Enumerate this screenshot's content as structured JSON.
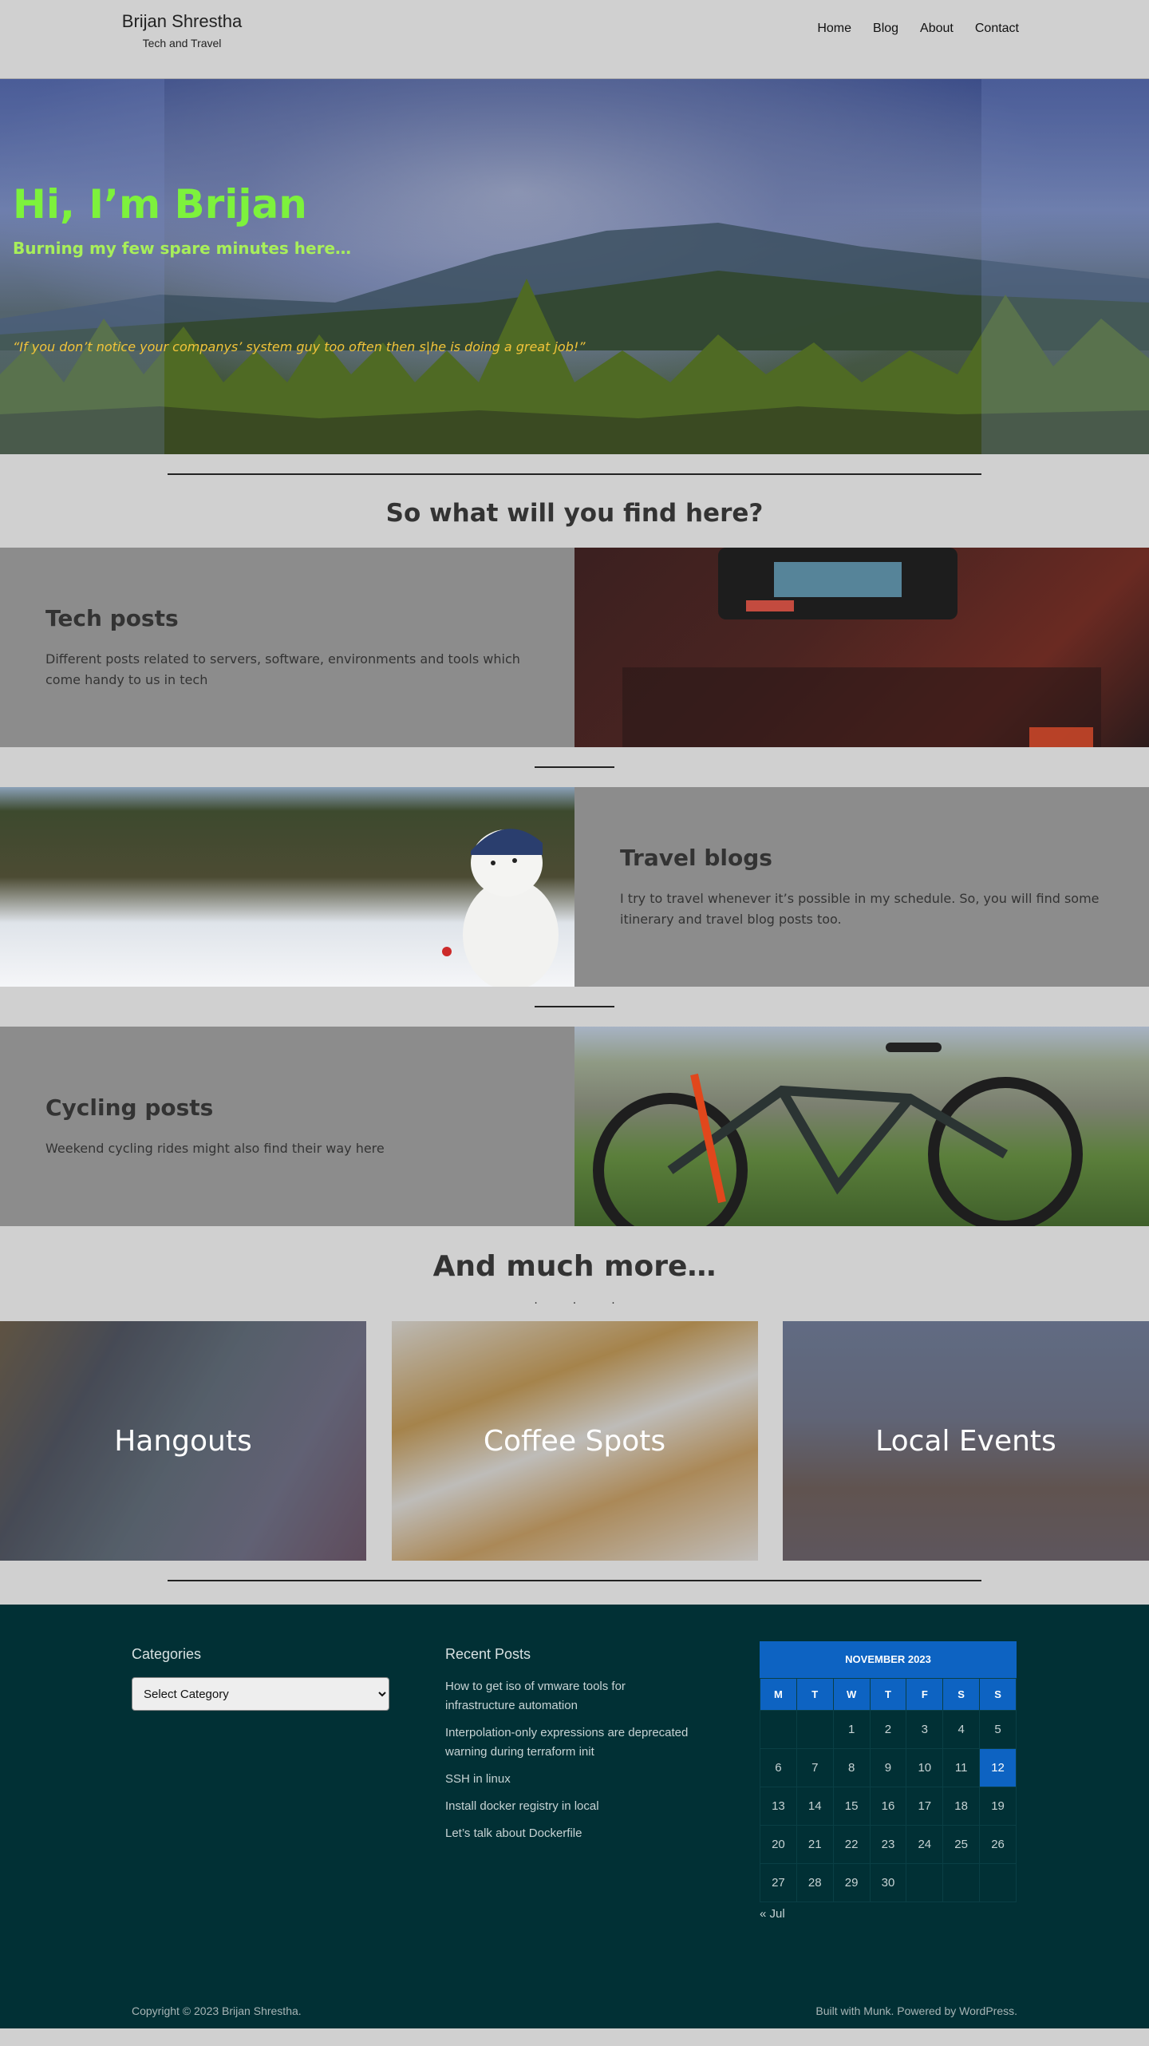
{
  "header": {
    "site_title": "Brijan Shrestha",
    "tagline": "Tech and Travel",
    "nav": [
      "Home",
      "Blog",
      "About",
      "Contact"
    ]
  },
  "hero": {
    "title": "Hi, I’m Brijan",
    "subtitle": "Burning my few spare minutes here…",
    "quote": "“If you don’t notice your companys’ system guy too often then s|he is doing a great job!”"
  },
  "intro_heading": "So what will you find here?",
  "features": [
    {
      "title": "Tech posts",
      "text": "Different posts related to servers, software, environments and tools which come handy to us in tech"
    },
    {
      "title": "Travel blogs",
      "text": "I try to travel whenever it’s possible in my schedule. So, you will find some itinerary and travel blog posts too."
    },
    {
      "title": "Cycling posts",
      "text": "Weekend cycling rides might also find their way here"
    }
  ],
  "more_heading": "And much more…",
  "dots": "...",
  "cards": [
    "Hangouts",
    "Coffee Spots",
    "Local Events"
  ],
  "footer": {
    "categories": {
      "heading": "Categories",
      "select_value": "Select Category"
    },
    "recent": {
      "heading": "Recent Posts",
      "posts": [
        "How to get iso of vmware tools for infrastructure automation",
        "Interpolation-only expressions are deprecated warning during terraform init",
        "SSH in linux",
        "Install docker registry in local",
        "Let’s talk about Dockerfile"
      ]
    },
    "calendar": {
      "caption": "NOVEMBER 2023",
      "weekdays": [
        "M",
        "T",
        "W",
        "T",
        "F",
        "S",
        "S"
      ],
      "weeks": [
        [
          "",
          "",
          "1",
          "2",
          "3",
          "4",
          "5"
        ],
        [
          "6",
          "7",
          "8",
          "9",
          "10",
          "11",
          "12"
        ],
        [
          "13",
          "14",
          "15",
          "16",
          "17",
          "18",
          "19"
        ],
        [
          "20",
          "21",
          "22",
          "23",
          "24",
          "25",
          "26"
        ],
        [
          "27",
          "28",
          "29",
          "30",
          "",
          "",
          ""
        ]
      ],
      "today": "12",
      "prev_link": "« Jul"
    },
    "copyright": "Copyright © 2023 Brijan Shrestha.",
    "credits_prefix": "Built with ",
    "credits_theme": "Munk",
    "credits_mid": ". Powered by ",
    "credits_wp": "WordPress",
    "credits_suffix": "."
  },
  "colors": {
    "hero_title": "#7df23c",
    "hero_quote": "#f2c43a",
    "footer_bg": "#013035",
    "calendar_accent": "#0d63c2"
  }
}
